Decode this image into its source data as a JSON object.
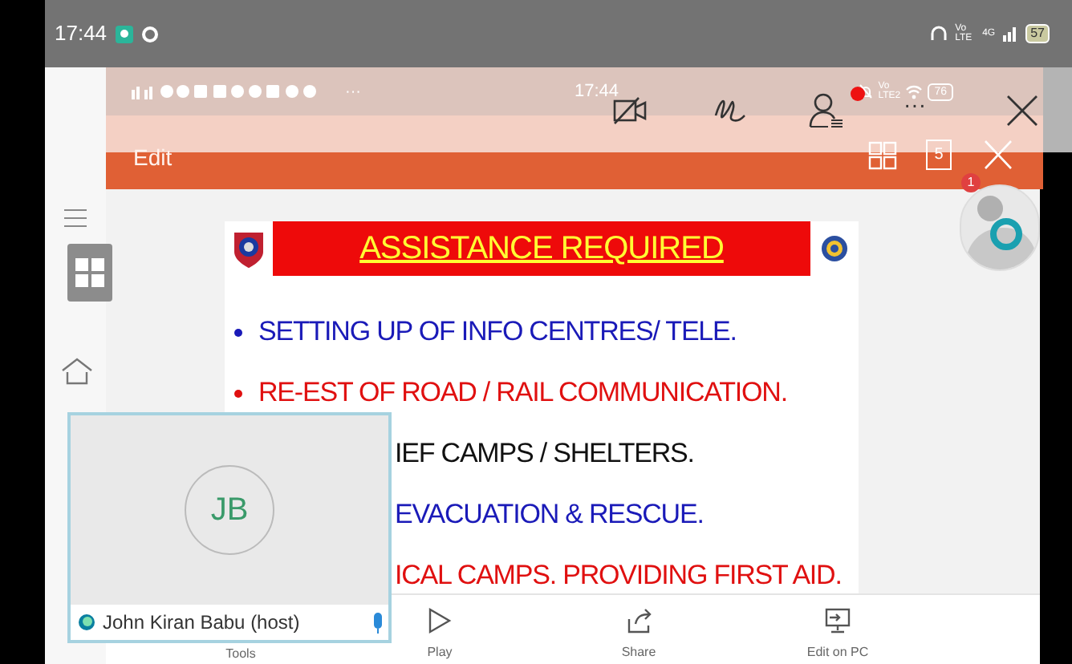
{
  "phone_status_bar": {
    "time": "17:44",
    "network": "Vo LTE",
    "signal": "4G",
    "battery": "57"
  },
  "shared_status_bar": {
    "time": "17:44",
    "more_notifications": "···",
    "network": "Vo LTE2",
    "battery": "76"
  },
  "meeting_toolbar": {
    "participants_alert": true,
    "more": "···"
  },
  "app_bar": {
    "title": "Edit",
    "slide_count": "5"
  },
  "avatar": {
    "badge": "1"
  },
  "slide": {
    "title": "ASSISTANCE REQUIRED",
    "items": [
      {
        "text": "SETTING UP OF INFO CENTRES/ TELE.",
        "color": "#1a1ab8",
        "covered": false
      },
      {
        "text": "RE-EST OF ROAD / RAIL COMMUNICATION.",
        "color": "#e01010",
        "covered": false
      },
      {
        "text": "IEF CAMPS / SHELTERS.",
        "color": "#111111",
        "covered": true
      },
      {
        "text": "EVACUATION & RESCUE.",
        "color": "#1a1ab8",
        "covered": true
      },
      {
        "text": "ICAL CAMPS. PROVIDING FIRST AID.",
        "color": "#e01010",
        "covered": true
      }
    ]
  },
  "video_tile": {
    "initials": "JB",
    "name": "John Kiran Babu (host)",
    "mic_on": true
  },
  "bottom_toolbar": [
    {
      "kind": "tools",
      "label": "Tools"
    },
    {
      "kind": "play",
      "label": "Play"
    },
    {
      "kind": "share",
      "label": "Share"
    },
    {
      "kind": "edit_pc",
      "label": "Edit on PC"
    }
  ]
}
